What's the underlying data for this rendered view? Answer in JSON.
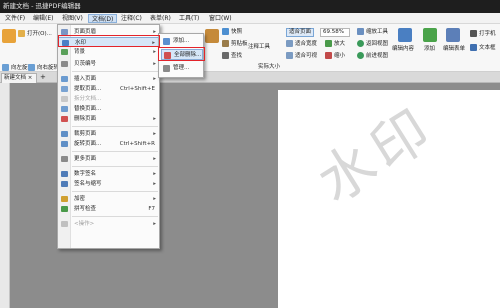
{
  "window": {
    "title": "新建文档 - 迅捷PDF编辑器"
  },
  "menubar": {
    "items": [
      "文件(F)",
      "编辑(E)",
      "视图(V)",
      "文档(D)",
      "注释(C)",
      "表单(R)",
      "工具(T)",
      "窗口(W)"
    ],
    "active_index": 3
  },
  "ribbon": {
    "open": "打开(O)...",
    "rotate_view": "向左旋转",
    "rotate_view2": "向右旋转",
    "snapshot": "快照",
    "clipboard": "剪贴板",
    "find": "查找",
    "actual_size": "实际大小",
    "fit_page": "适合页面",
    "fit_width": "适合宽度",
    "fit_visible": "适合可视",
    "zoom_value": "69.58%",
    "zoom_in": "放大",
    "zoom_out": "缩小",
    "zoom_tool": "缩放工具",
    "prev_view": "返回视图",
    "next_view": "前进视图",
    "edit_content": "编辑内容",
    "add": "添加",
    "edit_form": "编辑表单",
    "typewriter": "打字机",
    "textbox": "文本框",
    "annotation_tool": "注释工具"
  },
  "tabs": {
    "doc_tab": "新建文档",
    "plus": "+"
  },
  "document_menu": {
    "items": [
      {
        "label": "页面页眉",
        "arrow": true
      },
      {
        "label": "水印",
        "arrow": true
      },
      {
        "label": "背景",
        "arrow": true
      },
      {
        "label": "贝茨编号",
        "arrow": true
      },
      {
        "label": "插入页面",
        "arrow": true
      },
      {
        "label": "提取页面...",
        "shortcut": "Ctrl+Shift+E"
      },
      {
        "label": "拆分文档...",
        "disabled": true
      },
      {
        "label": "替换页面..."
      },
      {
        "label": "删除页面",
        "arrow": true
      },
      {
        "label": "裁剪页面",
        "arrow": true
      },
      {
        "label": "旋转页面...",
        "shortcut": "Ctrl+Shift+R"
      },
      {
        "label": "更多页面",
        "arrow": true
      },
      {
        "label": "数字签名",
        "arrow": true
      },
      {
        "label": "签名与缩写",
        "arrow": true
      },
      {
        "label": "加密",
        "arrow": true
      },
      {
        "label": "拼写检查",
        "shortcut": "F7"
      },
      {
        "label": "<操作>",
        "arrow": true,
        "disabled": true
      }
    ]
  },
  "watermark_submenu": {
    "items": [
      "添加...",
      "全部删除...",
      "管理..."
    ]
  },
  "page": {
    "watermark_text": "水印"
  },
  "colors": {
    "accent": "#e3242b",
    "highlight": "#d6e6f8"
  }
}
